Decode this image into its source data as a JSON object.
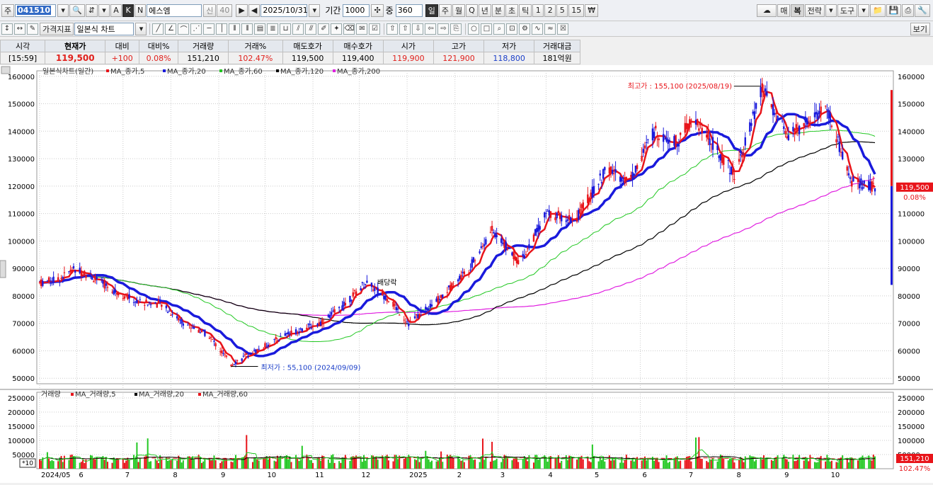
{
  "toolbar": {
    "market_label": "주",
    "code": "041510",
    "name": "에스엠",
    "btn_search": "신",
    "btn_hist": "40",
    "btn_a": "A",
    "btn_k": "K",
    "btn_n": "N",
    "date": "2025/10/31",
    "period_label": "기간",
    "period_value": "1000",
    "mid_label": "중",
    "mid_value": "360",
    "periods": [
      "일",
      "주",
      "월",
      "Q",
      "년",
      "분",
      "초",
      "틱",
      "1",
      "2",
      "5",
      "15"
    ],
    "right_buttons": [
      "매",
      "복",
      "전략",
      "도구"
    ],
    "indicator_btn": "가격지표",
    "chart_type": "일본식 차트",
    "view_btn": "보기"
  },
  "quote": {
    "headers": [
      "시각",
      "현재가",
      "대비",
      "대비%",
      "거래량",
      "거래%",
      "매도호가",
      "매수호가",
      "시가",
      "고가",
      "저가",
      "거래대금"
    ],
    "values": [
      "[15:59]",
      "119,500",
      "+100",
      "0.08%",
      "151,210",
      "102.47%",
      "119,500",
      "119,400",
      "119,900",
      "121,900",
      "118,800",
      "181억원"
    ]
  },
  "chart": {
    "legend_price": "일본식차트(일간)",
    "legend_ma": [
      {
        "name": "MA_종가,5",
        "color": "#e8141a"
      },
      {
        "name": "MA_종가,20",
        "color": "#1a1adc"
      },
      {
        "name": "MA_종가,60",
        "color": "#22c822"
      },
      {
        "name": "MA_종가,120",
        "color": "#000000"
      },
      {
        "name": "MA_종가,200",
        "color": "#e020e0"
      }
    ],
    "legend_vol": "거래량",
    "legend_vol_ma": [
      {
        "name": "MA_거래량,5",
        "color": "#e8141a"
      },
      {
        "name": "MA_거래량,20",
        "color": "#000000"
      },
      {
        "name": "MA_거래량,60",
        "color": "#e8141a"
      }
    ],
    "annotation_high": "최고가 : 155,100 (2025/08/19)",
    "annotation_low": "최저가 : 55,100 (2024/09/09)",
    "annotation_div": "배당락",
    "current_price": "119,500",
    "current_change": "0.08%",
    "current_volume": "151,210",
    "current_vol_pct": "102.47%",
    "vol_unit": "*10",
    "price_ticks": [
      "160000",
      "150000",
      "140000",
      "130000",
      "120000",
      "110000",
      "100000",
      "90000",
      "80000",
      "70000",
      "60000",
      "50000"
    ],
    "vol_ticks": [
      "250000",
      "200000",
      "150000",
      "100000",
      "50000"
    ],
    "x_labels": [
      "2024/05",
      "6",
      "7",
      "8",
      "9",
      "10",
      "11",
      "12",
      "2025",
      "2",
      "3",
      "4",
      "5",
      "6",
      "7",
      "8",
      "9",
      "10"
    ]
  },
  "chart_data": {
    "type": "candlestick",
    "price_range": [
      48000,
      162000
    ],
    "volume_range": [
      0,
      270000
    ],
    "close_path": [
      {
        "x": "2024/05",
        "close": 84000
      },
      {
        "x": "2024/05/20",
        "close": 86000
      },
      {
        "x": "2024/05/31",
        "close": 90000
      },
      {
        "x": "2024/06/10",
        "close": 87000
      },
      {
        "x": "2024/06/25",
        "close": 82000
      },
      {
        "x": "2024/07/10",
        "close": 78000
      },
      {
        "x": "2024/07/25",
        "close": 77000
      },
      {
        "x": "2024/08/10",
        "close": 70000
      },
      {
        "x": "2024/08/25",
        "close": 66000
      },
      {
        "x": "2024/09/09",
        "close": 55100
      },
      {
        "x": "2024/09/25",
        "close": 60000
      },
      {
        "x": "2024/10/15",
        "close": 66000
      },
      {
        "x": "2024/11/05",
        "close": 70000
      },
      {
        "x": "2024/11/20",
        "close": 76000
      },
      {
        "x": "2024/12/05",
        "close": 85000
      },
      {
        "x": "2024/12/20",
        "close": 79000
      },
      {
        "x": "2025/01/02",
        "close": 70000
      },
      {
        "x": "2025/01/20",
        "close": 78000
      },
      {
        "x": "2025/02/10",
        "close": 90000
      },
      {
        "x": "2025/02/25",
        "close": 104000
      },
      {
        "x": "2025/03/15",
        "close": 92000
      },
      {
        "x": "2025/04/01",
        "close": 110000
      },
      {
        "x": "2025/04/20",
        "close": 108000
      },
      {
        "x": "2025/05/10",
        "close": 126000
      },
      {
        "x": "2025/05/25",
        "close": 122000
      },
      {
        "x": "2025/06/10",
        "close": 140000
      },
      {
        "x": "2025/06/25",
        "close": 136000
      },
      {
        "x": "2025/07/05",
        "close": 145000
      },
      {
        "x": "2025/07/20",
        "close": 134000
      },
      {
        "x": "2025/08/01",
        "close": 124000
      },
      {
        "x": "2025/08/19",
        "close": 155100
      },
      {
        "x": "2025/09/05",
        "close": 138000
      },
      {
        "x": "2025/09/20",
        "close": 145000
      },
      {
        "x": "2025/09/30",
        "close": 148000
      },
      {
        "x": "2025/10/15",
        "close": 122000
      },
      {
        "x": "2025/10/31",
        "close": 119500
      }
    ]
  }
}
